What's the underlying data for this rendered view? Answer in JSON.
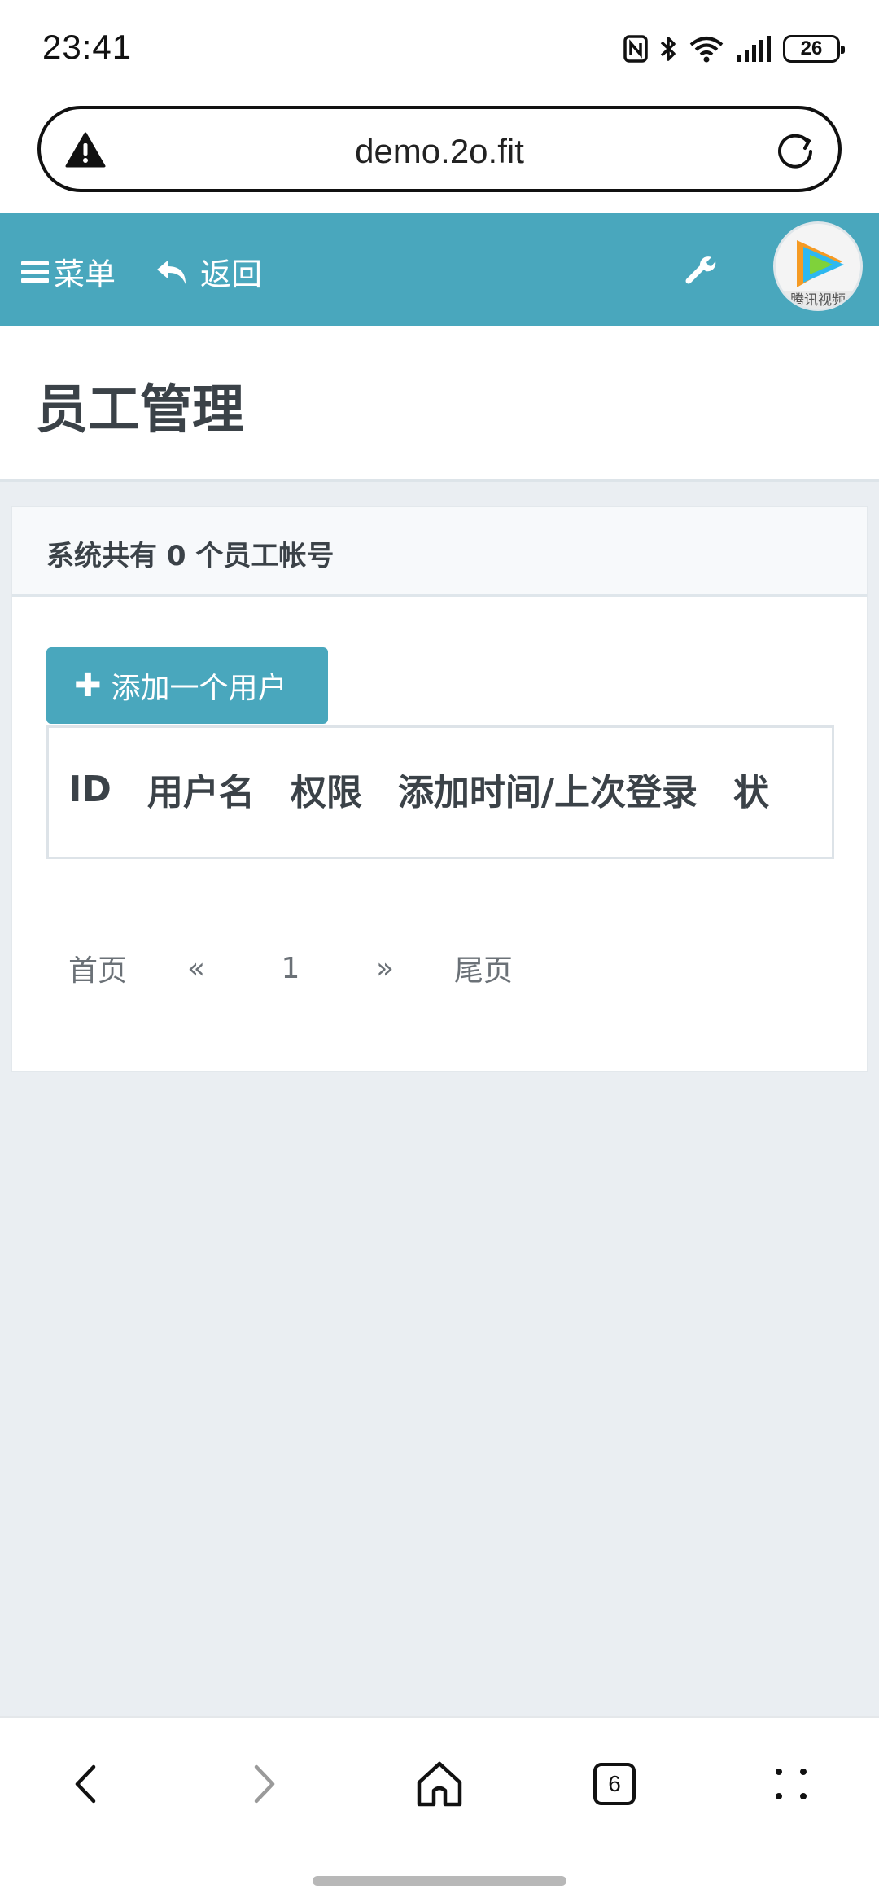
{
  "status_bar": {
    "time": "23:41",
    "battery": "26",
    "icons": [
      "nfc-icon",
      "bluetooth-icon",
      "wifi-icon",
      "signal-icon",
      "battery-icon"
    ]
  },
  "browser": {
    "url": "demo.2o.fit",
    "warning_icon": "warning-icon",
    "reload_icon": "reload-icon",
    "tab_count": "6"
  },
  "navbar": {
    "menu_label": "菜单",
    "back_label": "返回",
    "avatar_text": "腾讯视频",
    "color": "#49a7bd"
  },
  "page": {
    "title": "员工管理"
  },
  "panel": {
    "summary": "系统共有 0 个员工帐号",
    "add_button_label": "添加一个用户",
    "table": {
      "columns": [
        "ID",
        "用户名",
        "权限",
        "添加时间/上次登录",
        "状"
      ]
    },
    "pagination": {
      "first": "首页",
      "prev": "«",
      "current": "1",
      "next": "»",
      "last": "尾页"
    }
  }
}
